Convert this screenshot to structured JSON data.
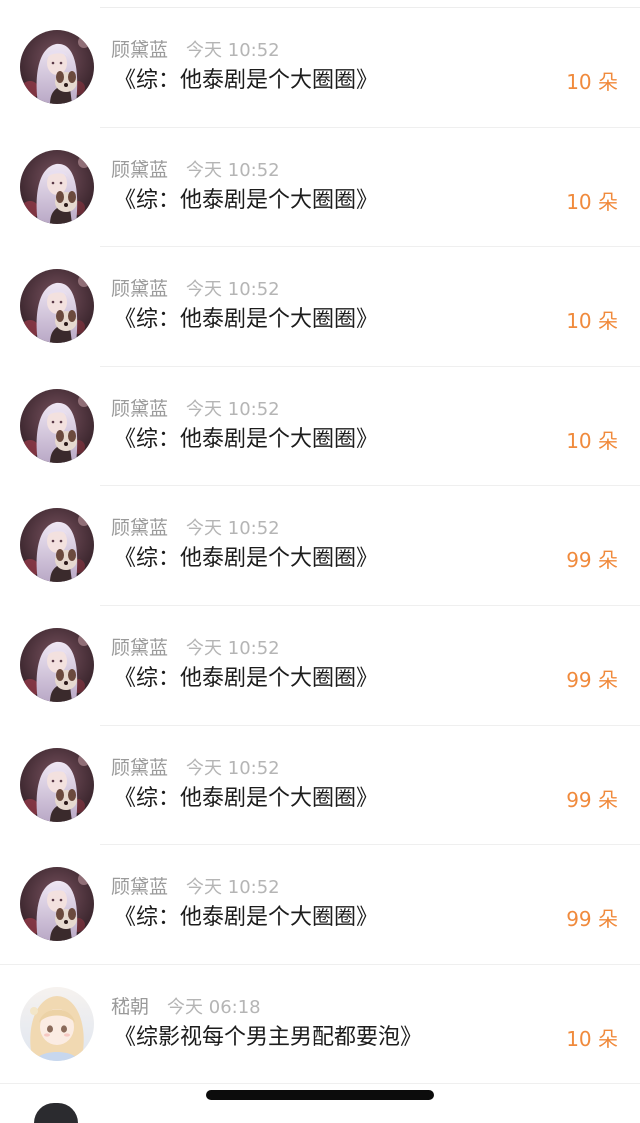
{
  "items": [
    {
      "name": "顾黛蓝",
      "time": "今天 10:52",
      "title": "《综：他泰剧是个大圈圈》",
      "amount": "10 朵",
      "avatar_icon": "girl-with-dog-avatar"
    },
    {
      "name": "顾黛蓝",
      "time": "今天 10:52",
      "title": "《综：他泰剧是个大圈圈》",
      "amount": "10 朵",
      "avatar_icon": "girl-with-dog-avatar"
    },
    {
      "name": "顾黛蓝",
      "time": "今天 10:52",
      "title": "《综：他泰剧是个大圈圈》",
      "amount": "10 朵",
      "avatar_icon": "girl-with-dog-avatar"
    },
    {
      "name": "顾黛蓝",
      "time": "今天 10:52",
      "title": "《综：他泰剧是个大圈圈》",
      "amount": "10 朵",
      "avatar_icon": "girl-with-dog-avatar"
    },
    {
      "name": "顾黛蓝",
      "time": "今天 10:52",
      "title": "《综：他泰剧是个大圈圈》",
      "amount": "99 朵",
      "avatar_icon": "girl-with-dog-avatar"
    },
    {
      "name": "顾黛蓝",
      "time": "今天 10:52",
      "title": "《综：他泰剧是个大圈圈》",
      "amount": "99 朵",
      "avatar_icon": "girl-with-dog-avatar"
    },
    {
      "name": "顾黛蓝",
      "time": "今天 10:52",
      "title": "《综：他泰剧是个大圈圈》",
      "amount": "99 朵",
      "avatar_icon": "girl-with-dog-avatar"
    },
    {
      "name": "顾黛蓝",
      "time": "今天 10:52",
      "title": "《综：他泰剧是个大圈圈》",
      "amount": "99 朵",
      "avatar_icon": "girl-with-dog-avatar"
    },
    {
      "name": "嵇朝",
      "time": "今天 06:18",
      "title": "《综影视每个男主男配都要泡》",
      "amount": "10 朵",
      "avatar_icon": "anime-girl-avatar"
    }
  ],
  "colors": {
    "amount": "#f08a3c",
    "name": "#9a9a9a",
    "time": "#b5b5b5",
    "title": "#1c1c1c"
  }
}
